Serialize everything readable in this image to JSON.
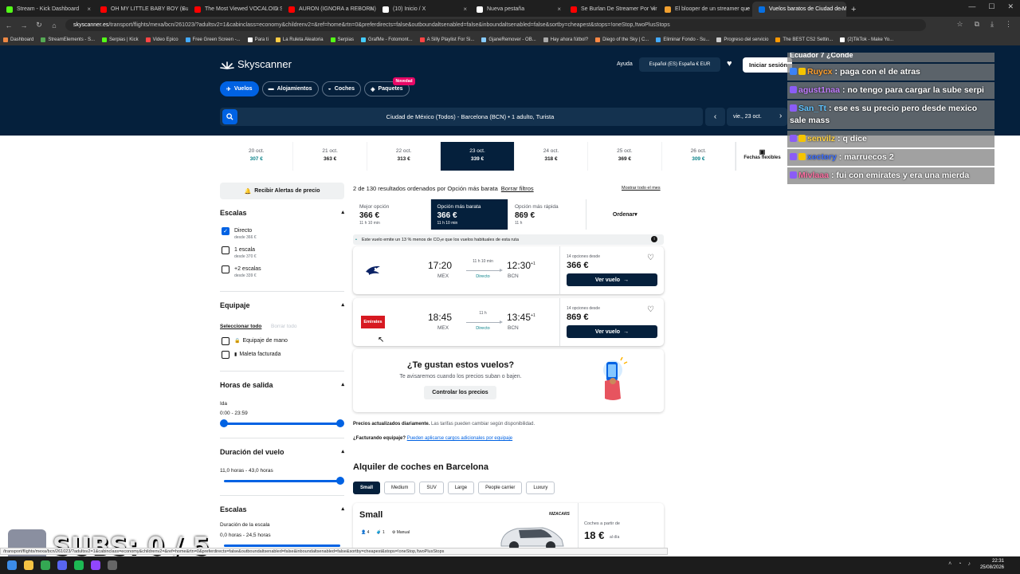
{
  "browser": {
    "tabs": [
      {
        "title": "Stream - Kick Dashboard",
        "color": "#53fc18"
      },
      {
        "title": "OH MY LITTLE BABY BOY (Sub",
        "color": "#ff0000"
      },
      {
        "title": "The Most Viewed VOCALOID S",
        "color": "#ff0000"
      },
      {
        "title": "AURON (IGNORA a REBORN)",
        "color": "#ff0000"
      },
      {
        "title": "(10) Inicio / X",
        "color": "#ffffff"
      },
      {
        "title": "Nueva pestaña",
        "color": "#ffffff"
      },
      {
        "title": "Se Burlan De Streamer Por Vir",
        "color": "#ff0000"
      },
      {
        "title": "El blooper de un streamer que",
        "color": "#f0a030"
      },
      {
        "title": "Vuelos baratos de Ciudad de M",
        "color": "#0770e3",
        "active": true
      }
    ],
    "url_domain": "skyscanner.es",
    "url_path": "/transport/flights/mexa/bcn/261023/?adultsv2=1&cabinclass=economy&childrenv2=&ref=home&rtn=0&preferdirects=false&outboundaltsenabled=false&inboundaltsenabled=false&sortby=cheapest&stops=!oneStop,!twoPlusStops",
    "bookmarks": [
      "Dashboard",
      "StreamElements - S...",
      "Serpias | Kick",
      "Video Epico",
      "Free Green Screen -...",
      "Para ti",
      "La Ruleta Aleatoria",
      "Serpias",
      "GrafMe - Fotomont...",
      "A Silly Playlist For Si...",
      "GjaneRemover - OB...",
      "Hay ahora fútbol?",
      "Diego of the Sky | C...",
      "Eliminar Fondo - Su...",
      "Progreso del servicio",
      "The BEST CS2 Settin...",
      "(2)TikTok - Make Yo..."
    ]
  },
  "site": {
    "logo": "Skyscanner",
    "help": "Ayuda",
    "locale": "Español (ES)  España  € EUR",
    "login": "Iniciar sesión",
    "pills": [
      {
        "label": "Vuelos",
        "icon": "plane-icon",
        "selected": true
      },
      {
        "label": "Alojamientos",
        "icon": "bed-icon"
      },
      {
        "label": "Coches",
        "icon": "car-icon"
      },
      {
        "label": "Paquetes",
        "icon": "package-icon",
        "badge": "Novedad"
      }
    ],
    "route": "Ciudad de México (Todos) - Barcelona (BCN)  •  1 adulto, Turista",
    "date": "vie., 23 oct."
  },
  "date_strip": [
    {
      "date": "20 oct.",
      "price": "307 €",
      "green": true
    },
    {
      "date": "21 oct.",
      "price": "363 €"
    },
    {
      "date": "22 oct.",
      "price": "313 €"
    },
    {
      "date": "23 oct.",
      "price": "339 €",
      "selected": true
    },
    {
      "date": "24 oct.",
      "price": "318 €"
    },
    {
      "date": "25 oct.",
      "price": "369 €"
    },
    {
      "date": "26 oct.",
      "price": "309 €",
      "green": true
    }
  ],
  "flexible_dates": "Fechas flexibles",
  "filters": {
    "alerts": "Recibir Alertas de precio",
    "stops_title": "Escalas",
    "stops": [
      {
        "label": "Directo",
        "sub": "desde 366 €",
        "checked": true
      },
      {
        "label": "1 escala",
        "sub": "desde 370 €",
        "checked": false
      },
      {
        "label": "+2 escalas",
        "sub": "desde 339 €",
        "checked": false
      }
    ],
    "baggage_title": "Equipaje",
    "select_all": "Seleccionar todo",
    "clear_all": "Borrar todo",
    "baggage": [
      "Equipaje de mano",
      "Maleta facturada"
    ],
    "departure_title": "Horas de salida",
    "departure_sub": "Ida",
    "departure_range": "0:00 - 23:59",
    "duration_title": "Duración del vuelo",
    "duration_range": "11,0 horas - 43,0 horas",
    "layover_title": "Escalas",
    "layover_sub": "Duración de la escala",
    "layover_range": "0,0 horas - 24,5 horas"
  },
  "results": {
    "count": "2 de 130 resultados ordenados por Opción más barata",
    "clear_filters": "Borrar filtros",
    "show_all": "Mostrar todo el mes",
    "sort_tabs": [
      {
        "label": "Mejor opción",
        "price": "366 €",
        "dur": "11 h 10 min"
      },
      {
        "label": "Opción más barata",
        "price": "366 €",
        "dur": "11 h 10 min",
        "selected": true
      },
      {
        "label": "Opción más rápida",
        "price": "869 €",
        "dur": "11 h"
      }
    ],
    "order": "Ordenar",
    "co2_note": "Este vuelo emite un 13 % menos de CO₂e que los vuelos habituales de esta ruta",
    "flights": [
      {
        "dep": "17:20",
        "arr": "12:30",
        "plus": "+1",
        "from": "MEX",
        "to": "BCN",
        "dur": "11 h 10 min",
        "stops": "Directo",
        "options": "14 opciones desde",
        "price": "366 €",
        "button": "Ver vuelo",
        "airline": "aeromexico-logo"
      },
      {
        "dep": "18:45",
        "arr": "13:45",
        "plus": "+1",
        "from": "MEX",
        "to": "BCN",
        "dur": "11 h",
        "stops": "Directo",
        "options": "14 opciones desde",
        "price": "869 €",
        "button": "Ver vuelo",
        "airline_label": "Emirates"
      }
    ],
    "like_title": "¿Te gustan estos vuelos?",
    "like_sub": "Te avisaremos cuando los precios suban o bajen.",
    "like_button": "Controlar los precios",
    "updated_bold": "Precios actualizados diariamente.",
    "updated_rest": " Las tarifas pueden cambiar según disponibilidad.",
    "bag_bold": "¿Facturando equipaje?",
    "bag_link": "Pueden aplicarse cargos adicionales por equipaje",
    "cars_title": "Alquiler de coches en Barcelona",
    "car_tabs": [
      "Small",
      "Medium",
      "SUV",
      "Large",
      "People carrier",
      "Luxury"
    ],
    "car": {
      "name": "Small",
      "seats": "4",
      "bags": "1",
      "gear": "Manual",
      "brand": "NIZACARS",
      "from": "Coches a partir de",
      "price": "18 €",
      "per": "al día"
    }
  },
  "chat": {
    "partial": "Ecuador 7 ¿Conde",
    "messages": [
      {
        "user": "Ruycx",
        "color": "#ff9f2b",
        "text": "paga con el de atras"
      },
      {
        "user": "agust1naa",
        "color": "#c27dff",
        "text": "no tengo para cargar la sube serpi"
      },
      {
        "user": "San_Tt",
        "color": "#5ec3ff",
        "text": "ese es su precio pero desde mexico sale mass"
      },
      {
        "user": "senvilz",
        "color": "#ffd23f",
        "text": "q dice"
      },
      {
        "user": "xectery",
        "color": "#3b6dff",
        "text": "marruecos 2"
      },
      {
        "user": "Mivlaaa",
        "color": "#ff6fa3",
        "text": "fui con emirates y era una mierda"
      }
    ]
  },
  "stream_overlay": {
    "subs": "SUBS: 0 / 5"
  },
  "taskbar": {
    "time": "22:31",
    "date": "25/08/2026"
  }
}
